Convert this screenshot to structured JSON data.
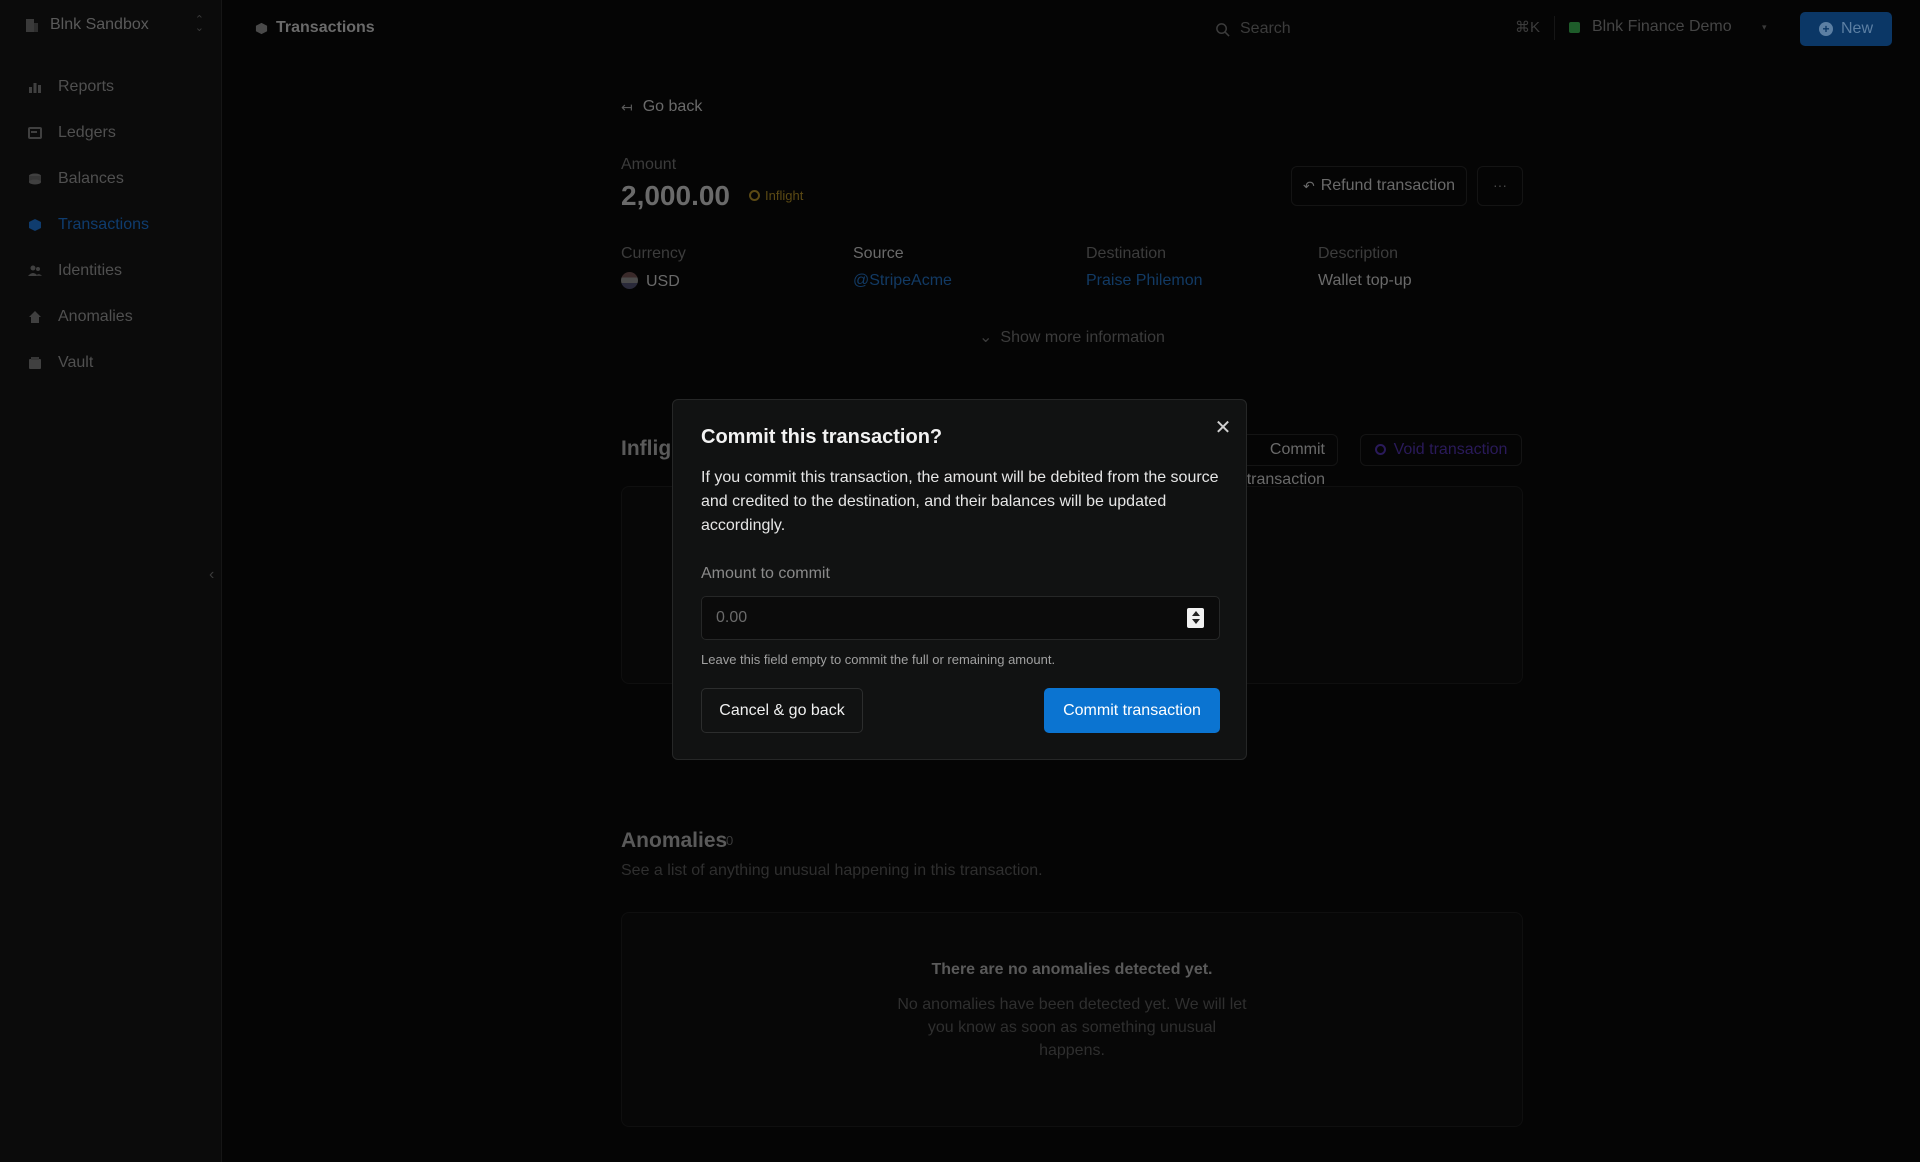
{
  "workspace": {
    "name": "Blnk Sandbox"
  },
  "sidebar": {
    "items": [
      {
        "label": "Reports",
        "icon": "bar-chart-icon"
      },
      {
        "label": "Ledgers",
        "icon": "ledger-icon"
      },
      {
        "label": "Balances",
        "icon": "coins-icon"
      },
      {
        "label": "Transactions",
        "icon": "transactions-icon",
        "active": true
      },
      {
        "label": "Identities",
        "icon": "users-icon"
      },
      {
        "label": "Anomalies",
        "icon": "alert-home-icon"
      },
      {
        "label": "Vault",
        "icon": "vault-icon"
      }
    ]
  },
  "topbar": {
    "breadcrumb": "Transactions",
    "search_placeholder": "Search",
    "search_shortcut": "⌘K",
    "org_name": "Blnk Finance Demo",
    "new_label": "New"
  },
  "transaction": {
    "go_back": "Go back",
    "amount_label": "Amount",
    "amount": "2,000.00",
    "status": "Inflight",
    "refund_label": "Refund transaction",
    "more_label": "···",
    "fields": {
      "currency_label": "Currency",
      "currency": "USD",
      "source_label": "Source",
      "source": "@StripeAcme",
      "destination_label": "Destination",
      "destination": "Praise Philemon",
      "description_label": "Description",
      "description": "Wallet top-up"
    },
    "show_more": "Show more information"
  },
  "inflight": {
    "title": "Inflight",
    "commit_label": "Commit transaction",
    "void_label": "Void transaction"
  },
  "anomalies": {
    "title": "Anomalies",
    "count": "0",
    "subtitle": "See a list of anything unusual happening in this transaction.",
    "empty_title": "There are no anomalies detected yet.",
    "empty_sub": "No anomalies have been detected yet. We will let you know as soon as something unusual happens."
  },
  "modal": {
    "title": "Commit this transaction?",
    "description": "If you commit this transaction, the amount will be debited from the source and credited to the destination, and their balances will be updated accordingly.",
    "amount_label": "Amount to commit",
    "amount_placeholder": "0.00",
    "help": "Leave this field empty to commit the full or remaining amount.",
    "cancel_label": "Cancel & go back",
    "commit_label": "Commit transaction"
  }
}
